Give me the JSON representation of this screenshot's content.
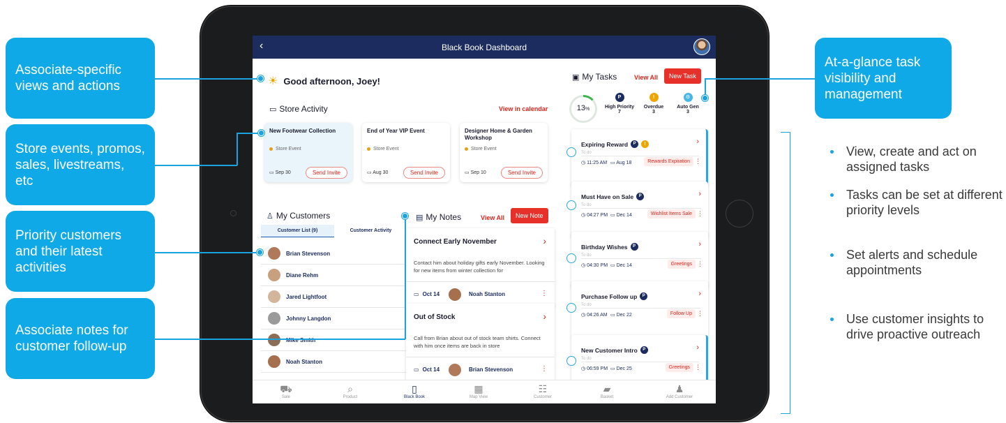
{
  "callouts": [
    "Associate-specific views and actions",
    "Store events, promos, sales, livestreams, etc",
    "Priority customers and their latest activities",
    "Associate notes for customer follow-up",
    "At-a-glance task visibility and management"
  ],
  "bullets": [
    "View, create and act on assigned tasks",
    "Tasks can be set at different priority levels",
    "Set alerts and schedule appointments",
    "Use customer insights to drive proactive outreach"
  ],
  "app": {
    "title": "Black Book Dashboard",
    "back": "‹",
    "greeting": "Good afternoon, Joey!"
  },
  "store_activity": {
    "title": "Store Activity",
    "view_calendar": "View in calendar",
    "events": [
      {
        "name": "New Footwear Collection",
        "type": "Store Event",
        "date": "Sep 30",
        "action": "Send Invite"
      },
      {
        "name": "End of Year VIP Event",
        "type": "Store Event",
        "date": "Aug 30",
        "action": "Send Invite"
      },
      {
        "name": "Designer Home & Garden Workshop",
        "type": "Store Event",
        "date": "Sep 10",
        "action": "Send Invite"
      }
    ]
  },
  "customers": {
    "title": "My Customers",
    "tabs": [
      "Customer List (9)",
      "Customer Activity"
    ],
    "list": [
      "Brian Stevenson",
      "Diane Rehm",
      "Jared Lightfoot",
      "Johnny Langdon",
      "Mike Smith",
      "Noah Stanton"
    ]
  },
  "notes": {
    "title": "My Notes",
    "view_all": "View All",
    "new_note": "New Note",
    "items": [
      {
        "title": "Connect Early November",
        "body": "Contact him about holiday gifts early November. Looking for new items from winter collection for",
        "date": "Oct 14",
        "customer": "Noah Stanton"
      },
      {
        "title": "Out of Stock",
        "body": "Call from Brian about out of stock team shirts. Connect with him once items are back in store",
        "date": "Oct 14",
        "customer": "Brian Stevenson"
      }
    ]
  },
  "tasks": {
    "title": "My Tasks",
    "view_all": "View All",
    "new_task": "New Task",
    "progress": "13",
    "progress_unit": "%",
    "stats": [
      {
        "label": "High Priority",
        "count": "7",
        "badge": "P",
        "color": "#1c2c5e"
      },
      {
        "label": "Overdue",
        "count": "3",
        "badge": "!",
        "color": "#f0a400"
      },
      {
        "label": "Auto Gen",
        "count": "3",
        "badge": "⚙",
        "color": "#49b6e6"
      }
    ],
    "todo_label": "To do",
    "items": [
      {
        "title": "Expiring Reward",
        "time": "11:25 AM",
        "date": "Aug 18",
        "tag": "Rewards Expiration"
      },
      {
        "title": "Must Have on Sale",
        "time": "04:27 PM",
        "date": "Dec 14",
        "tag": "Wishlist Items Sale"
      },
      {
        "title": "Birthday Wishes",
        "time": "04:30 PM",
        "date": "Dec 14",
        "tag": "Greetings"
      },
      {
        "title": "Purchase Follow up",
        "time": "04:26 AM",
        "date": "Dec 22",
        "tag": "Follow Up"
      },
      {
        "title": "New Customer Intro",
        "time": "06:59 PM",
        "date": "Dec 25",
        "tag": "Greetings"
      }
    ]
  },
  "nav": [
    "Sale",
    "Product",
    "Black Book",
    "Map View",
    "Customer",
    "Basket",
    "Add Customer"
  ]
}
